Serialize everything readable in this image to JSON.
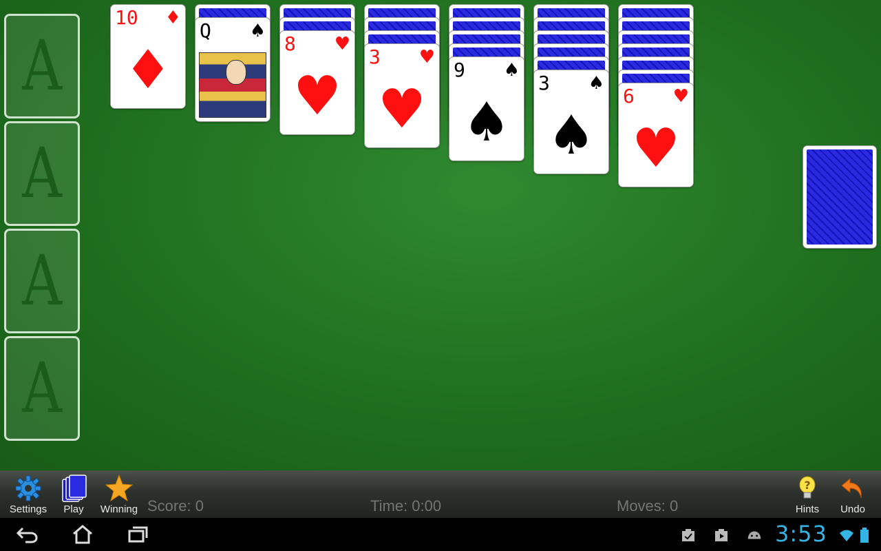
{
  "foundations": [
    {
      "label": "A"
    },
    {
      "label": "A"
    },
    {
      "label": "A"
    },
    {
      "label": "A"
    }
  ],
  "tableau": [
    {
      "face_down": 0,
      "top": {
        "rank": "10",
        "suit": "♦",
        "color": "red"
      }
    },
    {
      "face_down": 1,
      "top": {
        "rank": "Q",
        "suit": "♠",
        "color": "black"
      }
    },
    {
      "face_down": 2,
      "top": {
        "rank": "8",
        "suit": "♥",
        "color": "red"
      }
    },
    {
      "face_down": 3,
      "top": {
        "rank": "3",
        "suit": "♥",
        "color": "red"
      }
    },
    {
      "face_down": 4,
      "top": {
        "rank": "9",
        "suit": "♠",
        "color": "black"
      }
    },
    {
      "face_down": 5,
      "top": {
        "rank": "3",
        "suit": "♠",
        "color": "black"
      }
    },
    {
      "face_down": 6,
      "top": {
        "rank": "6",
        "suit": "♥",
        "color": "red"
      }
    }
  ],
  "toolbar": {
    "settings_label": "Settings",
    "play_label": "Play",
    "winning_label": "Winning",
    "hints_label": "Hints",
    "undo_label": "Undo"
  },
  "stats": {
    "score": "Score: 0",
    "time": "Time: 0:00",
    "moves": "Moves: 0"
  },
  "system": {
    "clock": "3:53"
  },
  "colors": {
    "felt": "#1f6f1f",
    "card_back": "#1a1ad0",
    "red_suit": "#ff1010",
    "clock": "#33b5e5"
  }
}
